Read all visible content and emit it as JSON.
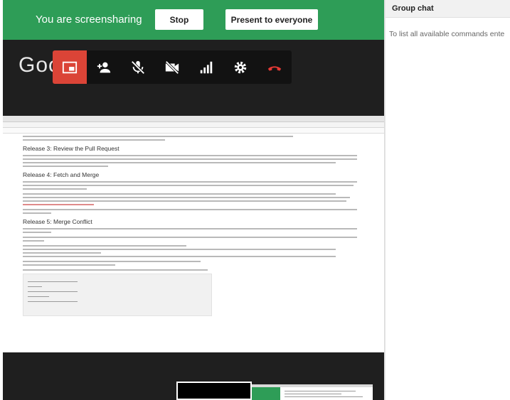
{
  "banner": {
    "message": "You are screensharing",
    "stop_label": "Stop",
    "present_label": "Present to everyone"
  },
  "logo_text": "Goo",
  "toolbar": {
    "buttons": [
      {
        "name": "picture-in-picture",
        "icon": "pip-icon"
      },
      {
        "name": "add-people",
        "icon": "add-person-icon"
      },
      {
        "name": "mute-mic",
        "icon": "mic-off-icon"
      },
      {
        "name": "camera-off",
        "icon": "camera-off-icon"
      },
      {
        "name": "signal",
        "icon": "signal-bars-icon"
      },
      {
        "name": "settings",
        "icon": "gear-icon"
      },
      {
        "name": "hang-up",
        "icon": "phone-hangup-icon"
      }
    ]
  },
  "shared_doc": {
    "heading_1": "Release 3: Review the Pull Request",
    "heading_2": "Release 4: Fetch and Merge",
    "heading_3": "Release 5: Merge Conflict"
  },
  "chat": {
    "title": "Group chat",
    "message": "To list all available commands ente"
  },
  "colors": {
    "banner_green": "#2e9d57",
    "active_red": "#db4437",
    "hangup_red": "#e53935"
  }
}
